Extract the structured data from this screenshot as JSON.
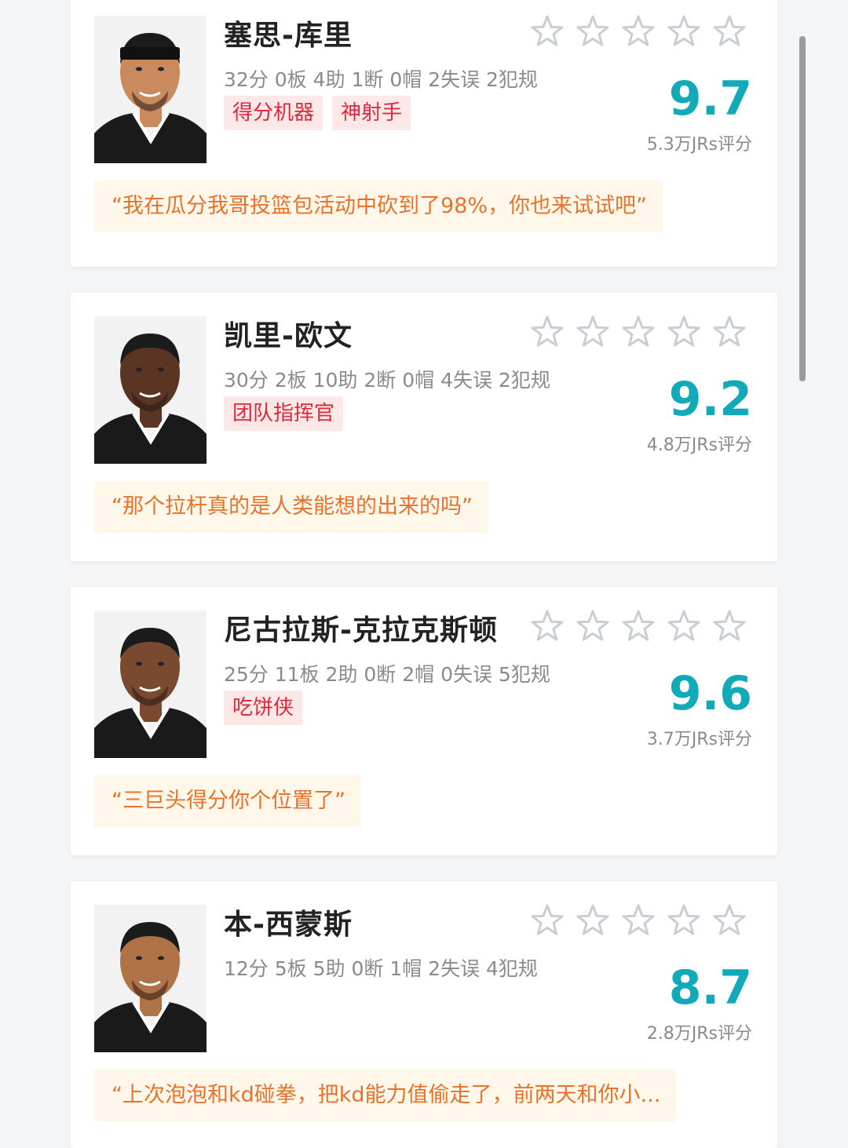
{
  "colors": {
    "score": "#12a9b8",
    "tag_text": "#e0273c",
    "tag_bg": "#fde8e8",
    "quote_text": "#e8722c",
    "quote_bg": "#fff8ea",
    "star_outline": "#c9ced4",
    "jersey": "#1a1a1a"
  },
  "players": [
    {
      "name": "塞思-库里",
      "stats": "32分 0板 4助 1断 0帽 2失误 2犯规",
      "tags": [
        "得分机器",
        "神射手"
      ],
      "score": "9.7",
      "votes": "5.3万JRs评分",
      "quote": "“我在瓜分我哥投篮包活动中砍到了98%，你也来试试吧”",
      "avatar_icon": "player-photo-icon",
      "rating_stars": 0
    },
    {
      "name": "凯里-欧文",
      "stats": "30分 2板 10助 2断 0帽 4失误 2犯规",
      "tags": [
        "团队指挥官"
      ],
      "score": "9.2",
      "votes": "4.8万JRs评分",
      "quote": "“那个拉杆真的是人类能想的出来的吗”",
      "avatar_icon": "player-photo-icon",
      "rating_stars": 0
    },
    {
      "name": "尼古拉斯-克拉克斯顿",
      "stats": "25分 11板 2助 0断 2帽 0失误 5犯规",
      "tags": [
        "吃饼侠"
      ],
      "score": "9.6",
      "votes": "3.7万JRs评分",
      "quote": "“三巨头得分你个位置了”",
      "avatar_icon": "player-photo-icon",
      "rating_stars": 0
    },
    {
      "name": "本-西蒙斯",
      "stats": "12分 5板 5助 0断 1帽 2失误 4犯规",
      "tags": [],
      "score": "8.7",
      "votes": "2.8万JRs评分",
      "quote": "“上次泡泡和kd碰拳，把kd能力值偷走了，前两天和你小...",
      "avatar_icon": "player-photo-icon",
      "rating_stars": 0
    }
  ]
}
